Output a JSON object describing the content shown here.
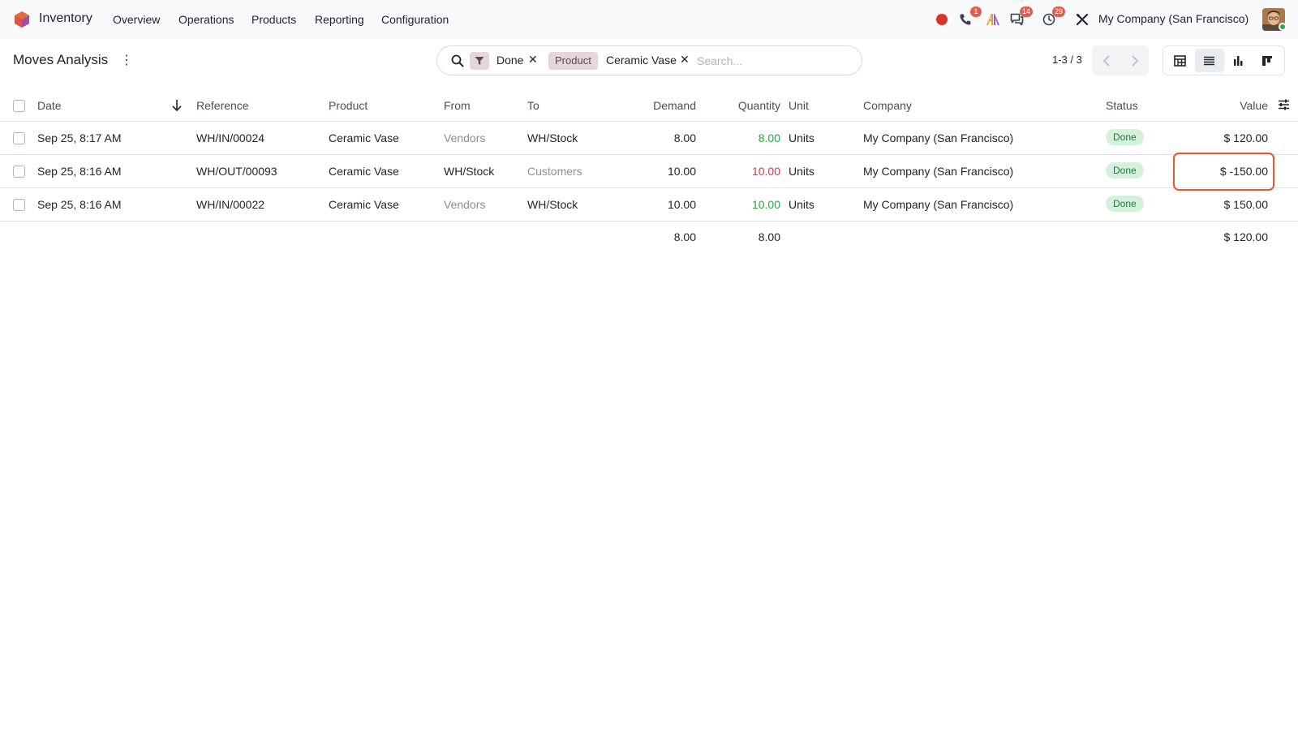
{
  "navbar": {
    "app_name": "Inventory",
    "menus": [
      "Overview",
      "Operations",
      "Products",
      "Reporting",
      "Configuration"
    ],
    "badges": {
      "phone": "1",
      "chat": "14",
      "activity": "29"
    },
    "company": "My Company (San Francisco)",
    "colors": {
      "record_dot": "#d9342b",
      "badge": "#e05d4f"
    }
  },
  "control": {
    "title": "Moves Analysis",
    "search": {
      "facets": [
        {
          "label": "",
          "value": "Done",
          "icon": "filter-icon"
        },
        {
          "label": "Product",
          "value": "Ceramic Vase"
        }
      ],
      "placeholder": "Search..."
    },
    "pager": "1-3 / 3",
    "views": [
      "pivot-icon",
      "list-icon",
      "graph-icon",
      "kanban-icon"
    ],
    "active_view": "list-icon"
  },
  "table": {
    "columns": [
      "Date",
      "Reference",
      "Product",
      "From",
      "To",
      "Demand",
      "Quantity",
      "Unit",
      "Company",
      "Status",
      "Value"
    ],
    "rows": [
      {
        "date": "Sep 25, 8:17 AM",
        "reference": "WH/IN/00024",
        "product": "Ceramic Vase",
        "from": "Vendors",
        "to": "WH/Stock",
        "demand": "8.00",
        "quantity": "8.00",
        "unit": "Units",
        "company": "My Company (San Francisco)",
        "status": "Done",
        "value": "$ 120.00",
        "quantity_color": "#28a745"
      },
      {
        "date": "Sep 25, 8:16 AM",
        "reference": "WH/OUT/00093",
        "product": "Ceramic Vase",
        "from": "WH/Stock",
        "to": "Customers",
        "demand": "10.00",
        "quantity": "10.00",
        "unit": "Units",
        "company": "My Company (San Francisco)",
        "status": "Done",
        "value": "$ -150.00",
        "quantity_color": "#dc3545"
      },
      {
        "date": "Sep 25, 8:16 AM",
        "reference": "WH/IN/00022",
        "product": "Ceramic Vase",
        "from": "Vendors",
        "to": "WH/Stock",
        "demand": "10.00",
        "quantity": "10.00",
        "unit": "Units",
        "company": "My Company (San Francisco)",
        "status": "Done",
        "value": "$ 150.00",
        "quantity_color": "#28a745"
      }
    ],
    "totals": {
      "demand": "8.00",
      "quantity": "8.00",
      "value": "$ 120.00"
    }
  }
}
